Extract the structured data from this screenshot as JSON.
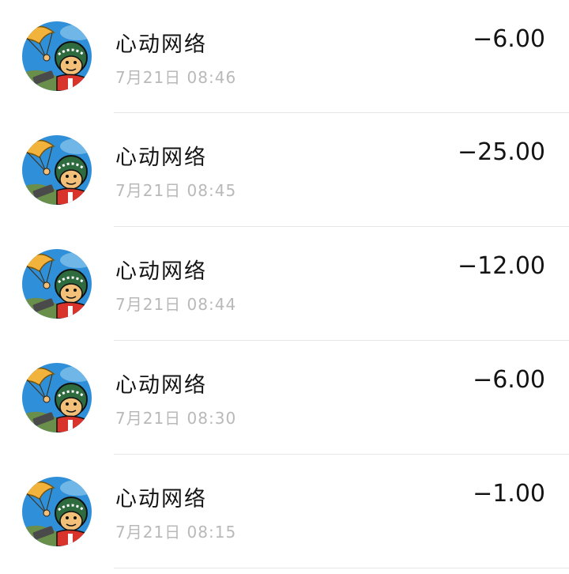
{
  "transactions": [
    {
      "name": "心动网络",
      "time": "7月21日 08:46",
      "amount": "−6.00"
    },
    {
      "name": "心动网络",
      "time": "7月21日 08:45",
      "amount": "−25.00"
    },
    {
      "name": "心动网络",
      "time": "7月21日 08:44",
      "amount": "−12.00"
    },
    {
      "name": "心动网络",
      "time": "7月21日 08:30",
      "amount": "−6.00"
    },
    {
      "name": "心动网络",
      "time": "7月21日 08:15",
      "amount": "−1.00"
    }
  ],
  "colors": {
    "sky": "#2f8fd8",
    "parachute": "#f2b33d",
    "helmet": "#2e6b3e",
    "shirt": "#d8342c",
    "skin": "#f3c07a",
    "ground": "#6a8f4a"
  },
  "icons": {
    "avatar": "paratrooper-cartoon-avatar"
  }
}
